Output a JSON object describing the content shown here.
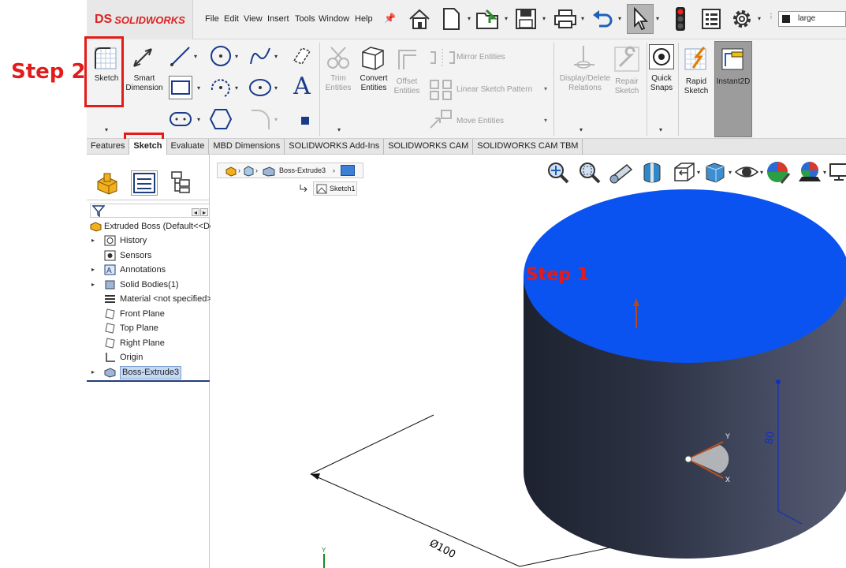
{
  "annotations": {
    "step2": "Step 2",
    "step1": "Step 1"
  },
  "app": {
    "brand": "SOLIDWORKS",
    "brand_mark": "DS"
  },
  "menus": [
    "File",
    "Edit",
    "View",
    "Insert",
    "Tools",
    "Window",
    "Help"
  ],
  "search": {
    "value": "large"
  },
  "ribbon": {
    "sketch": "Sketch",
    "smart_dimension": [
      "Smart",
      "Dimension"
    ],
    "trim_entities": [
      "Trim",
      "Entities"
    ],
    "convert_entities": [
      "Convert",
      "Entities"
    ],
    "offset_entities": [
      "Offset",
      "Entities"
    ],
    "mirror_entities": "Mirror Entities",
    "linear_sketch_pattern": "Linear Sketch Pattern",
    "move_entities": "Move Entities",
    "display_delete_relations": [
      "Display/Delete",
      "Relations"
    ],
    "repair_sketch": [
      "Repair",
      "Sketch"
    ],
    "quick_snaps": [
      "Quick",
      "Snaps"
    ],
    "rapid_sketch": [
      "Rapid",
      "Sketch"
    ],
    "instant2d": "Instant2D"
  },
  "tabs": [
    {
      "label": "Features",
      "active": false
    },
    {
      "label": "Sketch",
      "active": true
    },
    {
      "label": "Evaluate",
      "active": false
    },
    {
      "label": "MBD Dimensions",
      "active": false
    },
    {
      "label": "SOLIDWORKS Add-Ins",
      "active": false
    },
    {
      "label": "SOLIDWORKS CAM",
      "active": false
    },
    {
      "label": "SOLIDWORKS CAM TBM",
      "active": false
    }
  ],
  "tree": {
    "root": "Extruded Boss  (Default<<De",
    "items": [
      {
        "label": "History",
        "expandable": true
      },
      {
        "label": "Sensors",
        "expandable": false
      },
      {
        "label": "Annotations",
        "expandable": true
      },
      {
        "label": "Solid Bodies(1)",
        "expandable": true
      },
      {
        "label": "Material <not specified>",
        "expandable": false
      },
      {
        "label": "Front Plane",
        "expandable": false
      },
      {
        "label": "Top Plane",
        "expandable": false
      },
      {
        "label": "Right Plane",
        "expandable": false
      },
      {
        "label": "Origin",
        "expandable": false
      },
      {
        "label": "Boss-Extrude3",
        "expandable": true,
        "selected": true
      }
    ]
  },
  "breadcrumb": {
    "feature": "Boss-Extrude3",
    "sketch": "Sketch1"
  },
  "model": {
    "diameter_label": "Ø100",
    "height_label": "80",
    "triad_y": "Y",
    "triad_x": "X",
    "origin_y": "Y",
    "top_face_color": "#0a53f0",
    "body_color": "#2e3446"
  },
  "colors": {
    "highlight": "#e31b1b",
    "selection": "#0a53f0"
  }
}
